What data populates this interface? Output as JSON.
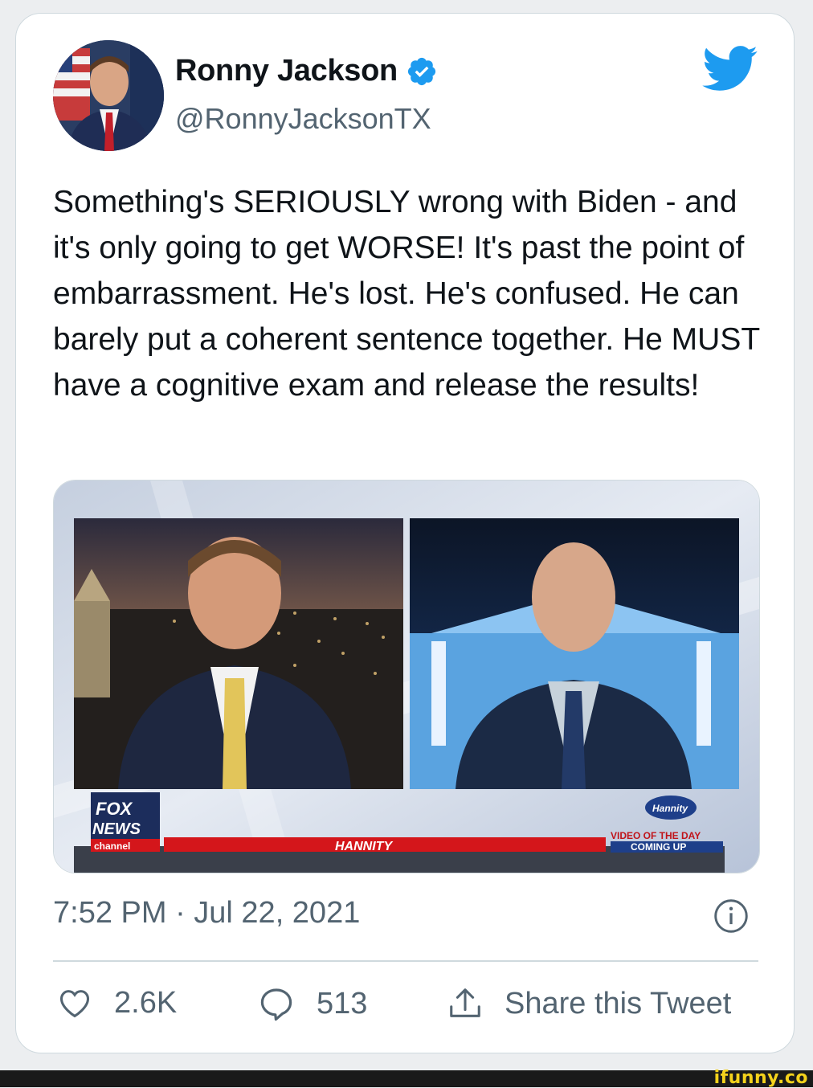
{
  "tweet": {
    "author_name": "Ronny Jackson",
    "author_handle": "@RonnyJacksonTX",
    "verified": true,
    "text": "Something's SERIOUSLY wrong with Biden - and it's only going to get WORSE! It's past the point of embarrassment. He's lost. He's confused. He can barely put a coherent sentence together. He MUST have a cognitive exam and release the results!",
    "timestamp": "7:52 PM · Jul 22, 2021",
    "likes": "2.6K",
    "replies": "513",
    "share_label": "Share this Tweet"
  },
  "media": {
    "network_logo_line1": "FOX",
    "network_logo_line2": "NEWS",
    "network_logo_line3": "channel",
    "show_name": "HANNITY",
    "promo_line1": "VIDEO OF THE DAY",
    "promo_line2": "COMING UP",
    "promo_badge": "Hannity"
  },
  "watermark": "ifunny.co",
  "icons": {
    "verified": "verified-badge-icon",
    "brand": "twitter-bird-icon",
    "info": "info-icon",
    "like": "heart-icon",
    "reply": "reply-bubble-icon",
    "share": "share-icon"
  },
  "colors": {
    "twitter_blue": "#1d9bf0",
    "text_primary": "#0f1419",
    "text_secondary": "#536471",
    "border": "#cfd9de",
    "fox_red": "#d4161b"
  }
}
